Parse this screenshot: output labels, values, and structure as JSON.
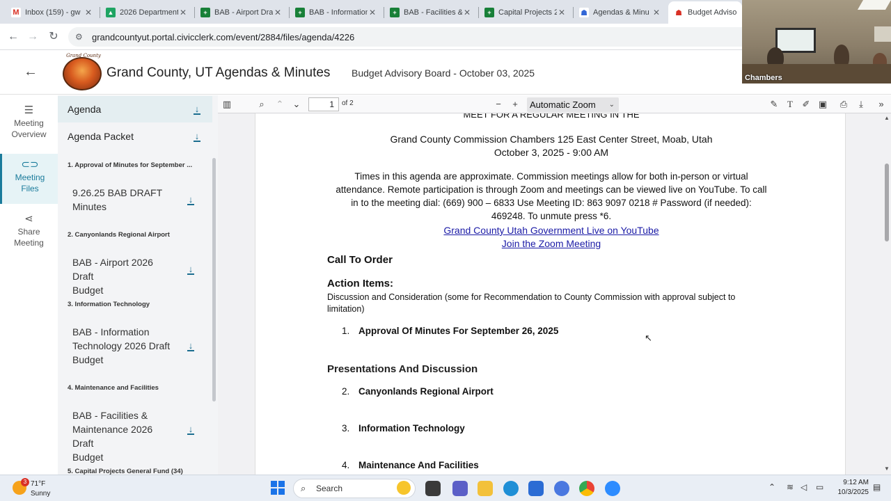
{
  "browser": {
    "tabs": [
      {
        "title": "Inbox (159) - gw",
        "icon": "gmail-icon",
        "color": "#d93025",
        "active": false
      },
      {
        "title": "2026 Department",
        "icon": "drive-icon",
        "color": "#1fa463",
        "active": false
      },
      {
        "title": "BAB - Airport Dra",
        "icon": "sheets-icon",
        "color": "#188038",
        "active": false
      },
      {
        "title": "BAB - Information",
        "icon": "sheets-icon",
        "color": "#188038",
        "active": false
      },
      {
        "title": "BAB - Facilities &",
        "icon": "sheets-icon",
        "color": "#188038",
        "active": false
      },
      {
        "title": "Capital Projects 2",
        "icon": "sheets-icon",
        "color": "#188038",
        "active": false
      },
      {
        "title": "Agendas & Minu",
        "icon": "civicclerk-icon",
        "color": "#3367d6",
        "active": false
      },
      {
        "title": "Budget Advisory",
        "icon": "civicclerk-icon",
        "color": "#d93025",
        "active": true
      }
    ],
    "url": "grandcountyut.portal.civicclerk.com/event/2884/files/agenda/4226"
  },
  "header": {
    "logo_text": "Grand County",
    "site_title": "Grand County, UT Agendas & Minutes",
    "meeting_title": "Budget Advisory Board - October 03, 2025"
  },
  "rail": {
    "items": [
      {
        "label_1": "Meeting",
        "label_2": "Overview",
        "icon": "list-icon",
        "active": false
      },
      {
        "label_1": "Meeting",
        "label_2": "Files",
        "icon": "paperclip-icon",
        "active": true
      },
      {
        "label_1": "Share",
        "label_2": "Meeting",
        "icon": "share-icon",
        "active": false
      }
    ]
  },
  "files": {
    "agenda": "Agenda",
    "agenda_packet": "Agenda Packet",
    "sections": [
      {
        "heading": "1. Approval of Minutes for September ...",
        "file_line1": "9.26.25 BAB DRAFT",
        "file_line2": "Minutes",
        "file_line3": ""
      },
      {
        "heading": "2. Canyonlands Regional Airport",
        "file_line1": "BAB - Airport 2026 Draft",
        "file_line2": "Budget",
        "file_line3": ""
      },
      {
        "heading": "3. Information Technology",
        "file_line1": "BAB - Information",
        "file_line2": "Technology 2026 Draft",
        "file_line3": "Budget"
      },
      {
        "heading": "4. Maintenance and Facilities",
        "file_line1": "BAB - Facilities &",
        "file_line2": "Maintenance 2026 Draft",
        "file_line3": "Budget"
      },
      {
        "heading": "5. Capital Projects General Fund (34)",
        "file_line1": "",
        "file_line2": "",
        "file_line3": ""
      }
    ]
  },
  "pdf_toolbar": {
    "page_number": "1",
    "page_count": "of 2",
    "zoom": "Automatic Zoom"
  },
  "pdf": {
    "cut_line": "MEET FOR A REGULAR MEETING IN THE",
    "location": "Grand County Commission Chambers 125 East Center Street, Moab, Utah",
    "date_time": "October 3, 2025 - 9:00 AM",
    "notice_1": "Times in this agenda are approximate. Commission meetings allow for both in-person or virtual",
    "notice_2": "attendance. Remote participation is through Zoom and meetings can be viewed live on YouTube. To call",
    "notice_3": "in to the meeting dial: (669) 900 – 6833 Use Meeting ID: 863 9097 0218 #   Password (if needed):",
    "notice_4": "469248. To unmute press *6.",
    "link_youtube": "Grand County Utah Government Live on YouTube",
    "link_zoom": "Join the Zoom Meeting",
    "call_to_order": "Call To Order",
    "action_items": "Action Items:",
    "action_desc_1": "Discussion and Consideration (some for Recommendation to County Commission with approval subject to",
    "action_desc_2": "limitation)",
    "item_1_num": "1.",
    "item_1": "Approval Of Minutes For September 26, 2025",
    "presentations": "Presentations And Discussion",
    "item_2_num": "2.",
    "item_2": "Canyonlands Regional Airport",
    "item_3_num": "3.",
    "item_3": "Information Technology",
    "item_4_num": "4.",
    "item_4": "Maintenance And Facilities"
  },
  "camera": {
    "label": "Chambers"
  },
  "taskbar": {
    "weather_temp": "71°F",
    "weather_cond": "Sunny",
    "weather_badge": "3",
    "search_label": "Search",
    "time": "9:12 AM",
    "date": "10/3/2025"
  },
  "colors": {
    "accent": "#1a7b9b",
    "link": "#1a1aa6",
    "rail_active_bg": "#e6f3f6"
  }
}
